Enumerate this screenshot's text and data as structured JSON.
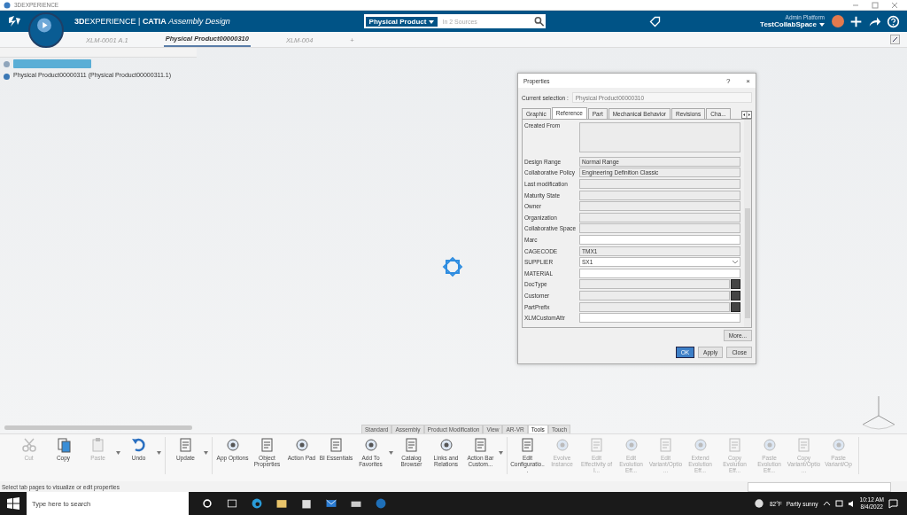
{
  "window": {
    "title": "3DEXPERIENCE"
  },
  "header": {
    "brand": "**3D**EXPERIENCE | **CATIA** *Assembly Design*",
    "search_scope": "Physical Product",
    "search": {
      "placeholder": "In 2 Sources"
    },
    "platform": "Admin Platform",
    "collab_space": "TestCollabSpace"
  },
  "tabs": [
    {
      "label": "XLM-0001 A.1",
      "selected": false
    },
    {
      "label": "Physical Product00000310",
      "selected": true
    },
    {
      "label": "XLM-004",
      "selected": false
    },
    {
      "label": "+",
      "selected": false
    }
  ],
  "tree": [
    {
      "selected": true,
      "children": [
        {
          "label": "Physical Product00000311 (Physical Product00000311.1)",
          "selected": false
        }
      ]
    }
  ],
  "properties": {
    "title": "Properties",
    "help": "?",
    "close": "×",
    "selection_label": "Current selection :",
    "selection_value": "Physical Product00000310",
    "tabs": [
      {
        "label": "Graphic",
        "selected": false
      },
      {
        "label": "Reference",
        "selected": true
      },
      {
        "label": "Part",
        "selected": false
      },
      {
        "label": "Mechanical Behavior",
        "selected": false
      },
      {
        "label": "Revisions",
        "selected": false
      },
      {
        "label": "Cha...",
        "selected": false
      }
    ],
    "fields": [
      {
        "label": "Created From",
        "kind": "area"
      },
      {
        "label": "Design Range",
        "kind": "readonly",
        "value": "Normal Range"
      },
      {
        "label": "Collaborative Policy",
        "kind": "readonly",
        "value": "Engineering Definition Classic"
      },
      {
        "label": "Last modification",
        "kind": "readonly"
      },
      {
        "label": "Maturity State",
        "kind": "readonly"
      },
      {
        "label": "Owner",
        "kind": "readonly"
      },
      {
        "label": "Organization",
        "kind": "readonly"
      },
      {
        "label": "Collaborative Space",
        "kind": "readonly"
      },
      {
        "label": "Marc",
        "kind": "edit"
      },
      {
        "label": "CAGECODE",
        "kind": "readonly",
        "value": "TMX1"
      },
      {
        "label": "SUPPLIER",
        "kind": "dropdown",
        "value": "SX1"
      },
      {
        "label": "MATERIAL",
        "kind": "edit"
      },
      {
        "label": "DocType",
        "kind": "browse"
      },
      {
        "label": "Customer",
        "kind": "browse"
      },
      {
        "label": "PartPrefix",
        "kind": "browse"
      },
      {
        "label": "XLMCustomAttr",
        "kind": "edit"
      }
    ],
    "more_button": "More...",
    "buttons": [
      {
        "label": "OK",
        "focused": true
      },
      {
        "label": "Apply",
        "focused": false
      },
      {
        "label": "Close",
        "focused": false
      }
    ]
  },
  "action_bar_tabs": [
    {
      "label": "Standard",
      "selected": false
    },
    {
      "label": "Assembly",
      "selected": false
    },
    {
      "label": "Product Modification",
      "selected": false
    },
    {
      "label": "View",
      "selected": false
    },
    {
      "label": "AR-VR",
      "selected": false
    },
    {
      "label": "Tools",
      "selected": true
    },
    {
      "label": "Touch",
      "selected": false
    }
  ],
  "toolbar": [
    [
      {
        "label": "Cut",
        "disabled": true,
        "menu": false
      },
      {
        "label": "Copy",
        "disabled": false,
        "menu": false
      },
      {
        "label": "Paste",
        "disabled": true,
        "menu": true
      },
      {
        "label": "Undo",
        "disabled": false,
        "menu": true
      }
    ],
    [
      {
        "label": "Update",
        "disabled": false,
        "menu": true
      }
    ],
    [
      {
        "label": "App Options",
        "disabled": false,
        "menu": false
      },
      {
        "label": "Object Properties",
        "disabled": false,
        "menu": false
      },
      {
        "label": "Action Pad",
        "disabled": false,
        "menu": false
      },
      {
        "label": "BI Essentials",
        "disabled": false,
        "menu": false
      },
      {
        "label": "Add To Favorites",
        "disabled": false,
        "menu": true
      },
      {
        "label": "Catalog Browser",
        "disabled": false,
        "menu": false
      },
      {
        "label": "Links and Relations",
        "disabled": false,
        "menu": false
      },
      {
        "label": "Action Bar Custom...",
        "disabled": false,
        "menu": true
      }
    ],
    [
      {
        "label": "Edit Configuratio...",
        "disabled": false,
        "menu": false
      },
      {
        "label": "Evolve Instance",
        "disabled": true,
        "menu": false
      },
      {
        "label": "Edit Effectivity of I...",
        "disabled": true,
        "menu": false
      },
      {
        "label": "Edit Evolution Eff...",
        "disabled": true,
        "menu": false
      },
      {
        "label": "Edit Variant/Optio...",
        "disabled": true,
        "menu": false
      },
      {
        "label": "Extend Evolution Eff...",
        "disabled": true,
        "menu": false
      },
      {
        "label": "Copy Evolution Eff...",
        "disabled": true,
        "menu": false
      },
      {
        "label": "Paste Evolution Eff...",
        "disabled": true,
        "menu": false
      },
      {
        "label": "Copy Variant/Optio...",
        "disabled": true,
        "menu": false
      },
      {
        "label": "Paste Variant/Op",
        "disabled": true,
        "menu": false
      }
    ]
  ],
  "status_bar": "Select tab pages to visualize or edit properties",
  "taskbar": {
    "search": {
      "placeholder": "Type here to search"
    },
    "temperature": "82°F",
    "weather": "Partly sunny",
    "time": "10:12 AM",
    "date": "8/4/2022"
  }
}
